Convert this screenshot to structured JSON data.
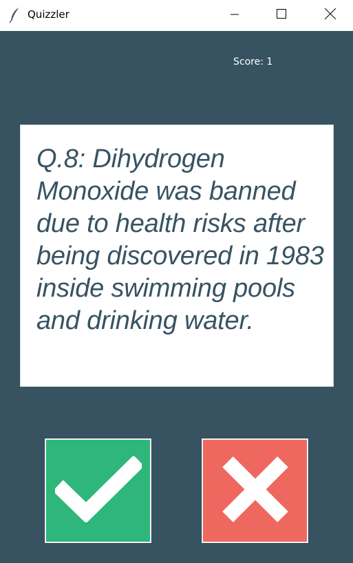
{
  "window": {
    "title": "Quizzler",
    "icon": "feather-icon"
  },
  "score": {
    "label": "Score: 1"
  },
  "question": {
    "text": "Q.8: Dihydrogen Monoxide was banned due to health risks after being discovered in 1983 inside swimming pools and drinking water."
  },
  "buttons": {
    "true_icon": "checkmark-icon",
    "false_icon": "cross-icon"
  },
  "colors": {
    "background": "#375362",
    "card": "#ffffff",
    "question_text": "#375362",
    "true_button": "#2fb67a",
    "false_button": "#ef6860"
  }
}
